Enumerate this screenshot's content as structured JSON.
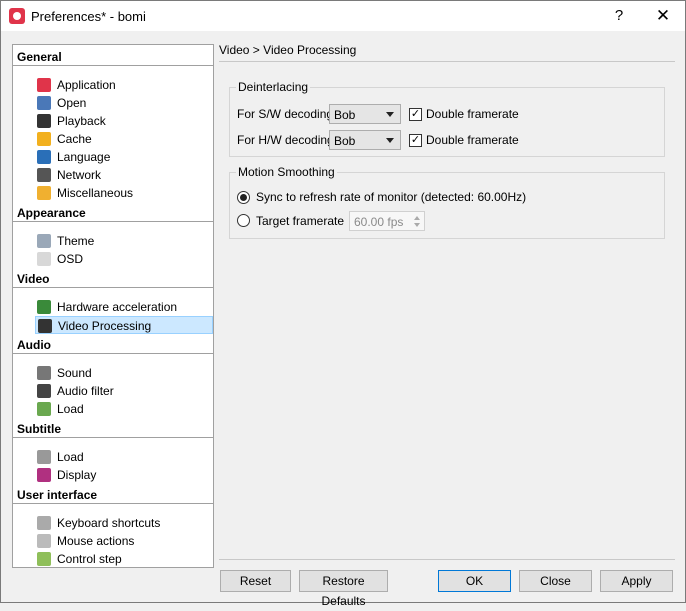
{
  "window": {
    "title": "Preferences* - bomi",
    "help": "?",
    "close": "✕"
  },
  "tree": {
    "categories": [
      {
        "label": "General",
        "items": [
          {
            "label": "Application",
            "icon": "app-icon",
            "color": "#e0344a"
          },
          {
            "label": "Open",
            "icon": "folder-icon",
            "color": "#4a78b8"
          },
          {
            "label": "Playback",
            "icon": "play-icon",
            "color": "#333333"
          },
          {
            "label": "Cache",
            "icon": "cache-icon",
            "color": "#f2b01e"
          },
          {
            "label": "Language",
            "icon": "language-icon",
            "color": "#2a6fb8"
          },
          {
            "label": "Network",
            "icon": "network-icon",
            "color": "#555555"
          },
          {
            "label": "Miscellaneous",
            "icon": "gear-icon",
            "color": "#f0b030"
          }
        ]
      },
      {
        "label": "Appearance",
        "items": [
          {
            "label": "Theme",
            "icon": "theme-icon",
            "color": "#9aa8b8"
          },
          {
            "label": "OSD",
            "icon": "osd-icon",
            "color": "#d8d8d8"
          }
        ]
      },
      {
        "label": "Video",
        "items": [
          {
            "label": "Hardware acceleration",
            "icon": "hardware-icon",
            "color": "#3a8a3a"
          },
          {
            "label": "Video Processing",
            "icon": "clapper-icon",
            "color": "#333333"
          }
        ]
      },
      {
        "label": "Audio",
        "items": [
          {
            "label": "Sound",
            "icon": "speaker-icon",
            "color": "#777777"
          },
          {
            "label": "Audio filter",
            "icon": "audio-filter-icon",
            "color": "#444444"
          },
          {
            "label": "Load",
            "icon": "music-note-icon",
            "color": "#6aa84f"
          }
        ]
      },
      {
        "label": "Subtitle",
        "items": [
          {
            "label": "Load",
            "icon": "subtitle-load-icon",
            "color": "#999999"
          },
          {
            "label": "Display",
            "icon": "text-icon",
            "color": "#b03080"
          }
        ]
      },
      {
        "label": "User interface",
        "items": [
          {
            "label": "Keyboard shortcuts",
            "icon": "keyboard-icon",
            "color": "#aaaaaa"
          },
          {
            "label": "Mouse actions",
            "icon": "mouse-icon",
            "color": "#bbbbbb"
          },
          {
            "label": "Control step",
            "icon": "control-icon",
            "color": "#8fbf5a"
          }
        ]
      }
    ]
  },
  "panel": {
    "breadcrumb": "Video > Video Processing",
    "deinterlacing": {
      "title": "Deinterlacing",
      "sw_label": "For S/W decoding",
      "sw_value": "Bob",
      "sw_double": "Double framerate",
      "hw_label": "For H/W decoding",
      "hw_value": "Bob",
      "hw_double": "Double framerate"
    },
    "motion": {
      "title": "Motion Smoothing",
      "sync_label": "Sync to refresh rate of monitor  (detected: 60.00Hz)",
      "target_label": "Target framerate",
      "target_value": "60.00 fps"
    }
  },
  "buttons": {
    "reset": "Reset",
    "restore": "Restore Defaults",
    "ok": "OK",
    "close": "Close",
    "apply": "Apply"
  }
}
